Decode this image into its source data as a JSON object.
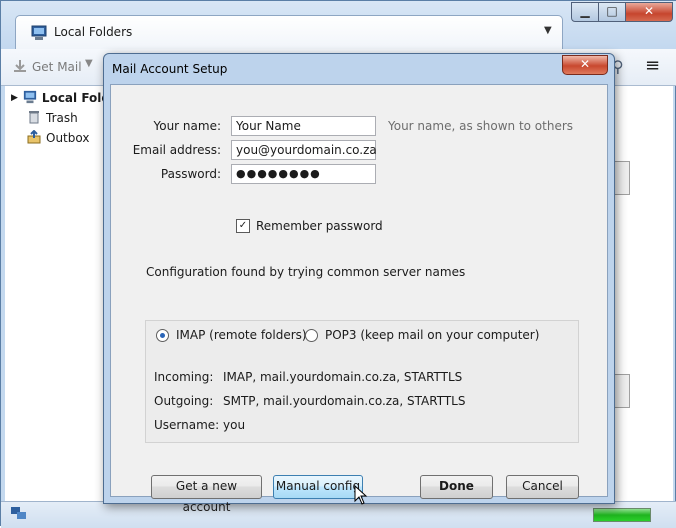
{
  "window": {
    "tab_title": "Local Folders",
    "tab_menu_glyph": "▼",
    "minimize_glyph": "▁",
    "maximize_glyph": "□",
    "close_glyph": "✕"
  },
  "toolbar": {
    "get_mail_label": "Get Mail",
    "dropdown_glyph": "▼",
    "search_glyph": "⚲",
    "menu_glyph": "≡"
  },
  "folders": {
    "local_folders": "Local Folders",
    "trash": "Trash",
    "outbox": "Outbox"
  },
  "dialog": {
    "title": "Mail Account Setup",
    "close_glyph": "✕",
    "labels": {
      "name": "Your name:",
      "email": "Email address:",
      "password": "Password:"
    },
    "name_value": "Your Name",
    "name_hint": "Your name, as shown to others",
    "email_value": "you@yourdomain.co.za",
    "password_value": "●●●●●●●●",
    "remember_label": "Remember password",
    "remember_checked": true,
    "check_glyph": "✓",
    "config_message": "Configuration found by trying common server names",
    "protocol_imap": "IMAP (remote folders)",
    "protocol_pop3": "POP3 (keep mail on your computer)",
    "selected_protocol": "IMAP",
    "incoming_label": "Incoming:",
    "incoming_value": "IMAP, mail.yourdomain.co.za, STARTTLS",
    "outgoing_label": "Outgoing:",
    "outgoing_value": "SMTP, mail.yourdomain.co.za, STARTTLS",
    "username_label": "Username:",
    "username_value": "you",
    "buttons": {
      "get_account": "Get a new account",
      "manual_config": "Manual config",
      "done": "Done",
      "cancel": "Cancel"
    }
  },
  "status": {
    "progress_fraction": 1.0,
    "progress_color": "#1fb41f"
  },
  "colors": {
    "window_frame": "#c4d9ef",
    "dialog_frame": "#bdd3ec",
    "dialog_body": "#f0f0f0",
    "close_red": "#c8482f",
    "selected_button": "#bee6fd"
  }
}
